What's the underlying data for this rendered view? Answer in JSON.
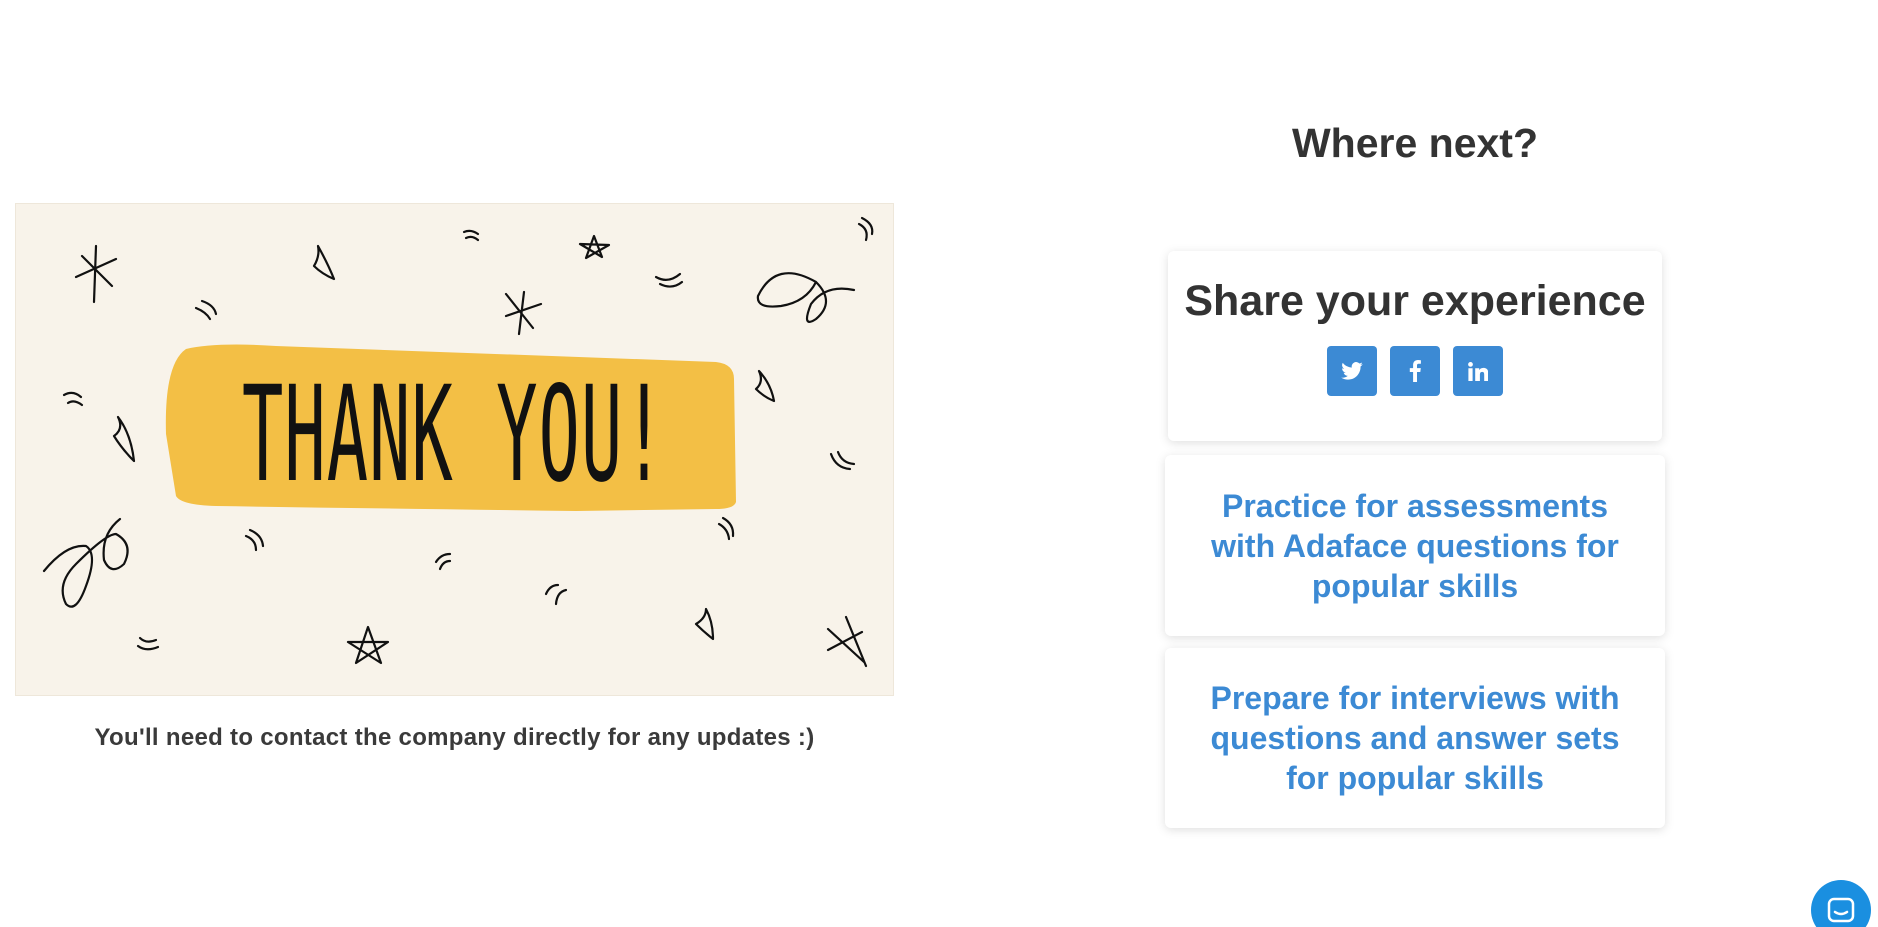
{
  "thank_you": {
    "banner_text": "THANK YOU!",
    "note": "You'll need to contact the company directly for any updates :)"
  },
  "where_next": {
    "title": "Where next?",
    "share": {
      "title": "Share your experience",
      "buttons": [
        {
          "icon": "twitter-icon",
          "glyph": "twitter"
        },
        {
          "icon": "facebook-icon",
          "glyph": "f"
        },
        {
          "icon": "linkedin-icon",
          "glyph": "in"
        }
      ]
    },
    "links": [
      {
        "label": "Practice for assessments with Adaface questions for popular skills"
      },
      {
        "label": "Prepare for interviews with questions and answer sets for popular skills"
      }
    ]
  },
  "colors": {
    "accent": "#3c8ad4",
    "banner_yellow": "#f3bf45",
    "card_bg": "#f8f3ea",
    "chat_blue": "#1a8fe0"
  },
  "chat": {
    "icon": "chat-icon"
  }
}
